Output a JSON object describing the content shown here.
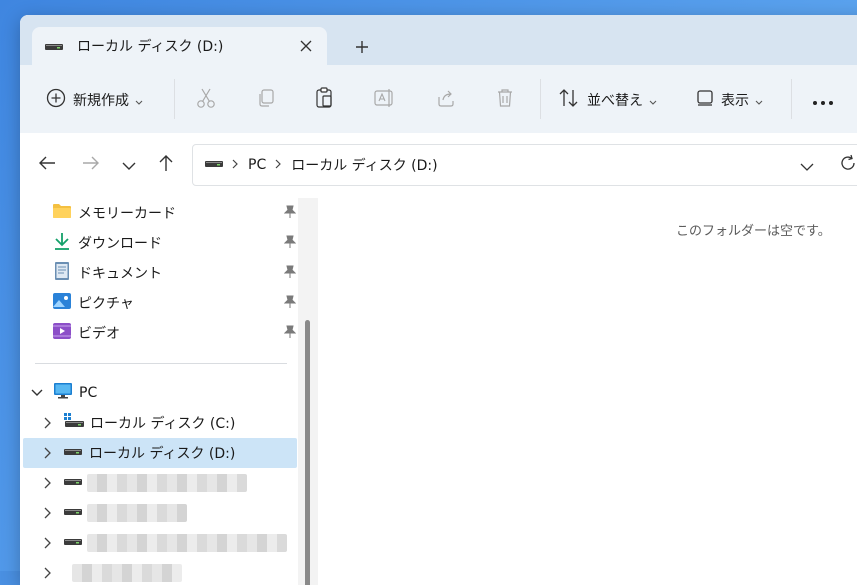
{
  "tab": {
    "title": "ローカル ディスク (D:)"
  },
  "toolbar": {
    "new_label": "新規作成",
    "sort_label": "並べ替え",
    "view_label": "表示"
  },
  "address": {
    "crumbs": [
      "PC",
      "ローカル ディスク (D:)"
    ]
  },
  "quick_access": [
    {
      "label": "メモリーカード",
      "icon": "folder-icon"
    },
    {
      "label": "ダウンロード",
      "icon": "download-icon"
    },
    {
      "label": "ドキュメント",
      "icon": "document-icon"
    },
    {
      "label": "ピクチャ",
      "icon": "pictures-icon"
    },
    {
      "label": "ビデオ",
      "icon": "video-icon"
    }
  ],
  "tree": {
    "pc_label": "PC",
    "drives": [
      {
        "label": "ローカル ディスク (C:)",
        "selected": false
      },
      {
        "label": "ローカル ディスク (D:)",
        "selected": true
      }
    ]
  },
  "content": {
    "empty_message": "このフォルダーは空です。"
  },
  "colors": {
    "selection": "#cce4f7",
    "accent": "#0067c0"
  }
}
